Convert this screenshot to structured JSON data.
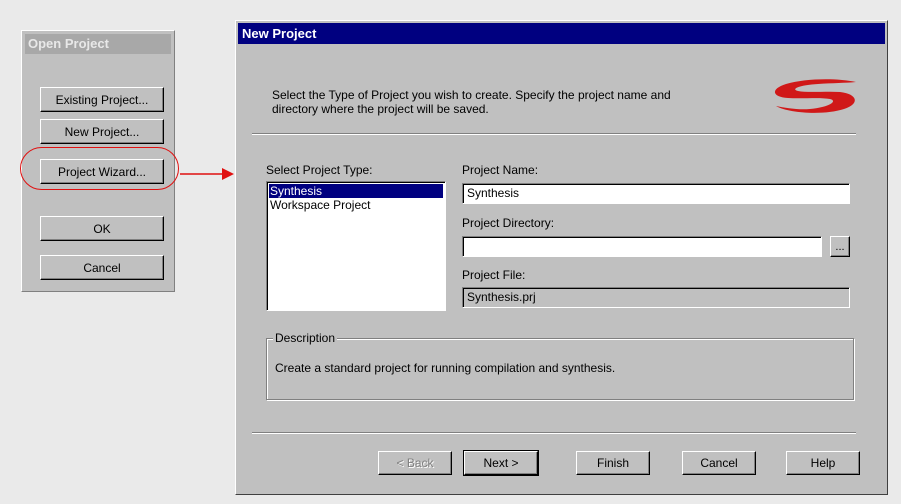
{
  "open_project": {
    "title": "Open Project",
    "buttons": {
      "existing": "Existing Project...",
      "new": "New Project...",
      "wizard": "Project Wizard...",
      "ok": "OK",
      "cancel": "Cancel"
    }
  },
  "new_project": {
    "title": "New Project",
    "instructions_line1": "Select the Type of Project you wish to create.   Specify the project name and",
    "instructions_line2": "directory where the project will be saved.",
    "select_type_label": "Select Project Type:",
    "project_types": [
      "Synthesis",
      "Workspace Project"
    ],
    "selected_type": "Synthesis",
    "project_name_label": "Project Name:",
    "project_name_value": "Synthesis",
    "project_dir_label": "Project Directory:",
    "project_dir_value": "",
    "browse_label": "...",
    "project_file_label": "Project File:",
    "project_file_value": "Synthesis.prj",
    "description_label": "Description",
    "description_text": "Create a standard project for running compilation and synthesis.",
    "buttons": {
      "back": "< Back",
      "next": "Next >",
      "finish": "Finish",
      "cancel": "Cancel",
      "help": "Help"
    }
  },
  "colors": {
    "title_active": "#000080",
    "title_inactive": "#a8a8a8",
    "highlight_red": "#e01010",
    "logo_red": "#d01818"
  },
  "icons": {
    "logo": "synplicity-swoosh-logo",
    "arrow": "red-arrow-right"
  }
}
